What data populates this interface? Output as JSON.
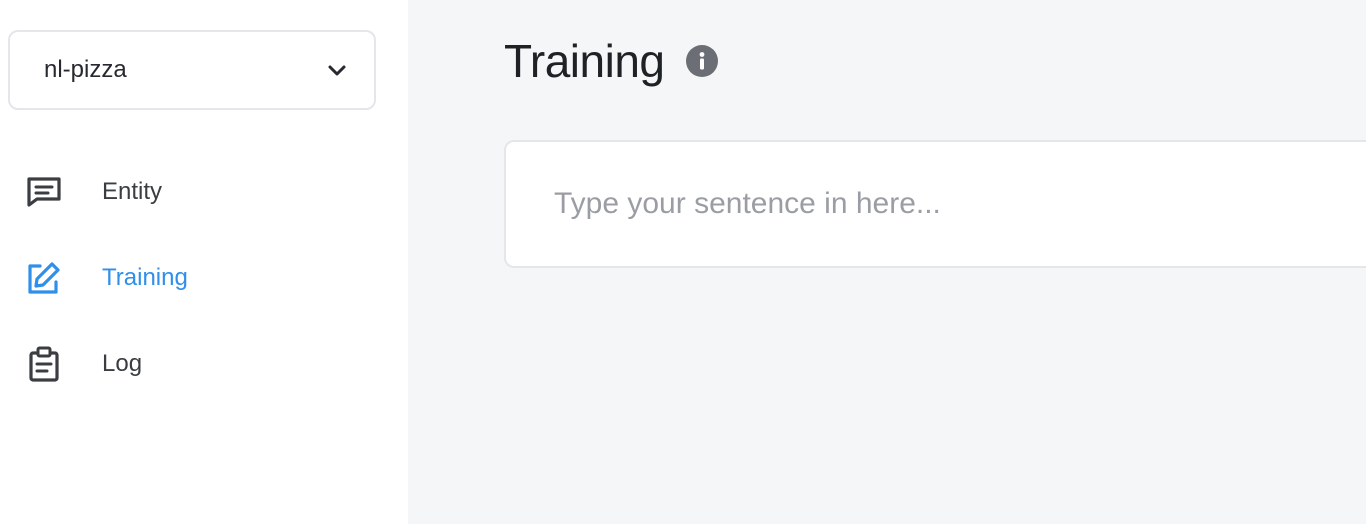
{
  "sidebar": {
    "project_select": {
      "value": "nl-pizza"
    },
    "nav": [
      {
        "label": "Entity",
        "icon": "message-square-icon",
        "active": false
      },
      {
        "label": "Training",
        "icon": "edit-icon",
        "active": true
      },
      {
        "label": "Log",
        "icon": "clipboard-icon",
        "active": false
      }
    ]
  },
  "main": {
    "title": "Training",
    "info_icon": "info-icon",
    "sentence_input": {
      "placeholder": "Type your sentence in here...",
      "value": ""
    }
  },
  "colors": {
    "accent": "#2f8fe9",
    "text": "#3a3d42",
    "sidebar_bg": "#ffffff",
    "main_bg": "#f5f6f8"
  }
}
